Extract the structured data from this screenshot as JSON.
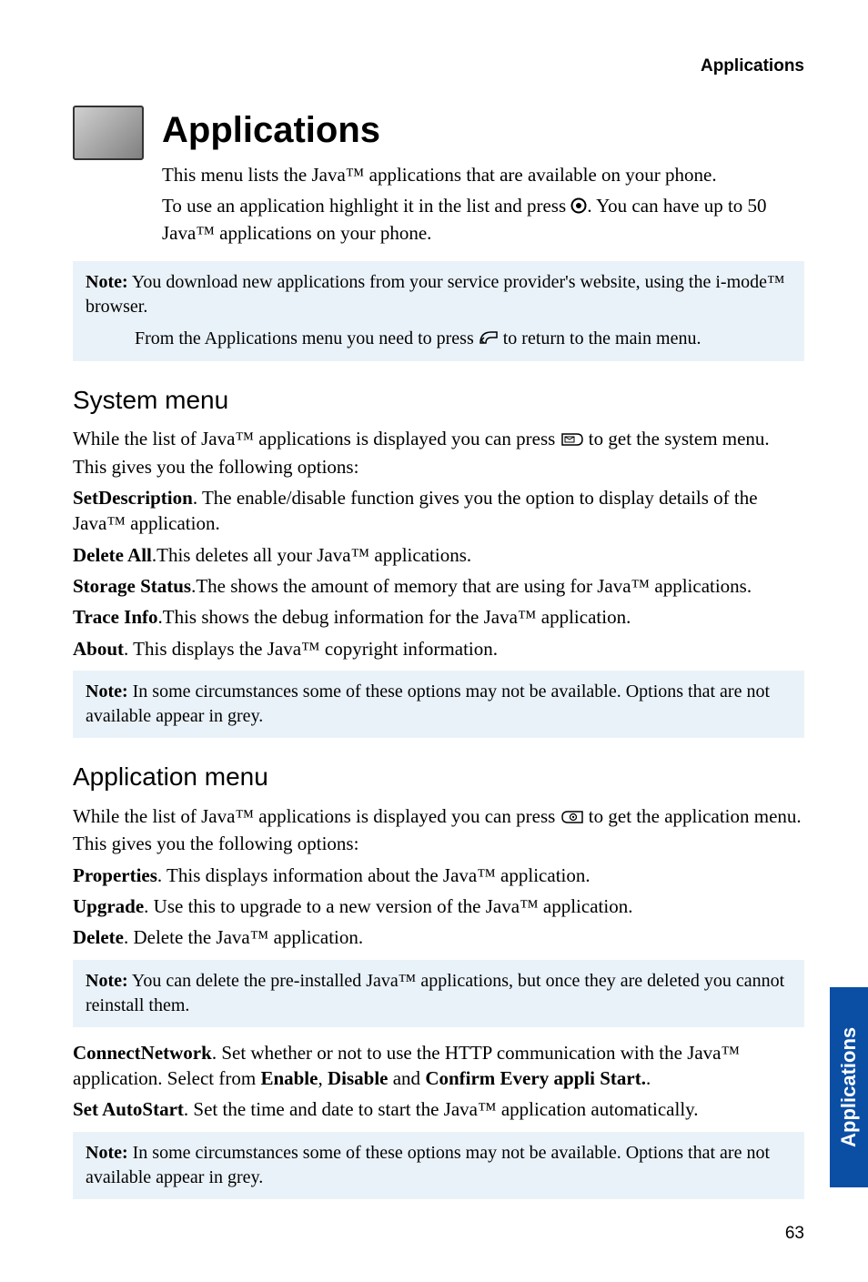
{
  "header": {
    "running_head": "Applications"
  },
  "title": "Applications",
  "intro": {
    "p1": "This menu lists the Java™ applications that are available on your phone.",
    "p2a": "To use an application highlight it in the list and press ",
    "p2b": ". You can have up to 50 Java™ applications on your phone."
  },
  "note1": {
    "label": "Note:",
    "text": " You download new applications from your service provider's website, using the i-mode™ browser.",
    "sub_a": "From the Applications menu you need to press ",
    "sub_b": " to return to the main menu."
  },
  "system_menu": {
    "heading": "System menu",
    "p1a": "While the list of Java™ applications is displayed you can press ",
    "p1b": " to get the system menu. This gives you the following options:",
    "setdesc_label": "SetDescription",
    "setdesc_text": ". The enable/disable function gives you the option to display details of the Java™ application.",
    "deleteall_label": "Delete All",
    "deleteall_text": ".This deletes all your Java™ applications.",
    "storage_label": "Storage Status",
    "storage_text": ".The shows the amount of memory that are using for Java™ applications.",
    "trace_label": "Trace Info",
    "trace_text": ".This shows the debug information for the Java™ application.",
    "about_label": "About",
    "about_text": ". This displays the Java™ copyright information."
  },
  "note2": {
    "label": "Note:",
    "text": " In some circumstances some of these options may not be available. Options that are not available appear in grey."
  },
  "app_menu": {
    "heading": "Application menu",
    "p1a": "While the list of Java™ applications is displayed you can press ",
    "p1b": " to get the application menu. This gives you the following options:",
    "props_label": "Properties",
    "props_text": ". This displays information about the Java™ application.",
    "upgrade_label": "Upgrade",
    "upgrade_text": ". Use this to upgrade to a new version of the Java™ application.",
    "delete_label": "Delete",
    "delete_text": ". Delete the Java™ application."
  },
  "note3": {
    "label": "Note:",
    "text": " You can delete the pre-installed Java™ applications, but once they are deleted you cannot reinstall them."
  },
  "connect": {
    "label": "ConnectNetwork",
    "text_a": ". Set whether or not to use the HTTP communication with the Java™ application. Select from ",
    "enable": "Enable",
    "sep1": ", ",
    "disable": "Disable",
    "sep2": " and ",
    "confirm": "Confirm Every appli Start.",
    "tail": "."
  },
  "autostart": {
    "label": "Set AutoStart",
    "text": ". Set the time and date to start the Java™ application automatically."
  },
  "note4": {
    "label": "Note:",
    "text": " In some circumstances some of these options may not be available. Options that are not available appear in grey."
  },
  "side_tab": "Applications",
  "page_number": "63"
}
